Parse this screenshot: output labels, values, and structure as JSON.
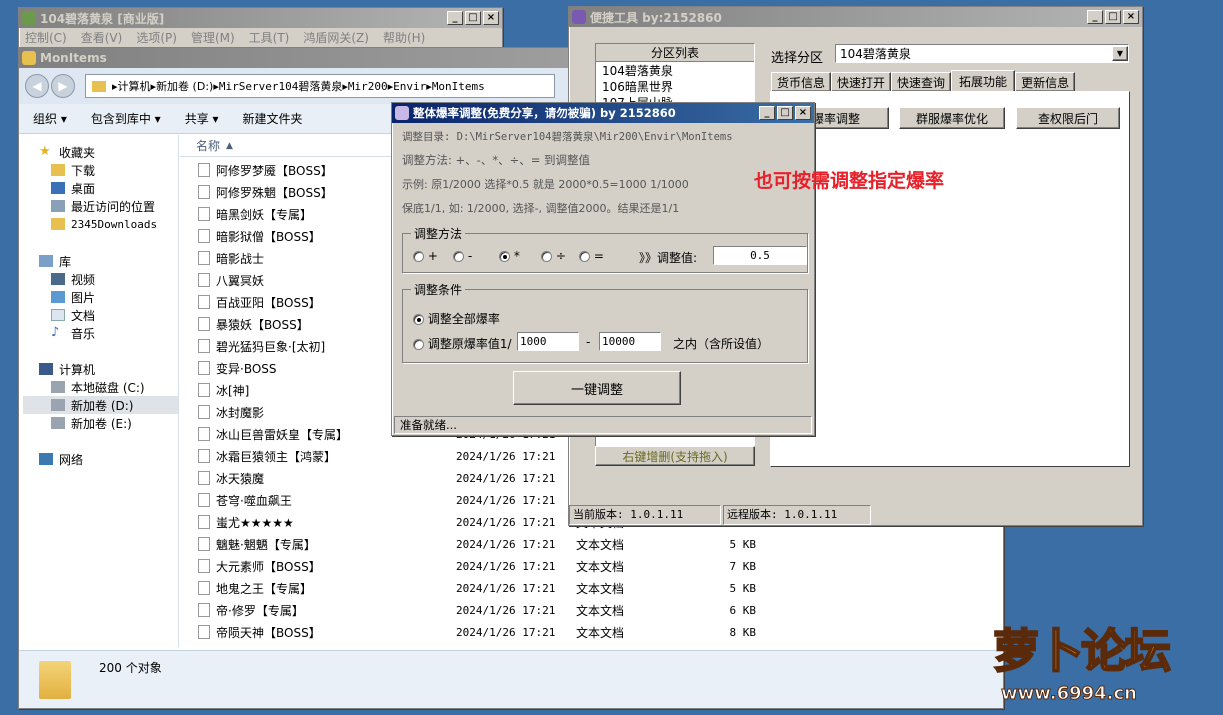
{
  "bg_window": {
    "title": "104碧落黄泉 [商业版]",
    "menu": [
      "控制(C)",
      "查看(V)",
      "选项(P)",
      "管理(M)",
      "工具(T)",
      "鸿盾网关(Z)",
      "帮助(H)"
    ]
  },
  "explorer": {
    "title": "MonItems",
    "path": [
      "计算机",
      "新加卷 (D:)",
      "MirServer104碧落黄泉",
      "Mir200",
      "Envir",
      "MonItems"
    ],
    "toolbar": [
      "组织 ▾",
      "包含到库中 ▾",
      "共享 ▾",
      "新建文件夹"
    ],
    "col_name": "名称",
    "sidebar": {
      "favorites": "收藏夹",
      "fav_items": [
        "下载",
        "桌面",
        "最近访问的位置",
        "2345Downloads"
      ],
      "libraries": "库",
      "lib_items": [
        "视频",
        "图片",
        "文档",
        "音乐"
      ],
      "computer": "计算机",
      "comp_items": [
        "本地磁盘 (C:)",
        "新加卷 (D:)",
        "新加卷 (E:)"
      ],
      "network": "网络"
    },
    "files": [
      {
        "name": "阿修罗梦魇【BOSS】",
        "date": "",
        "type": "",
        "size": ""
      },
      {
        "name": "阿修罗殊魍【BOSS】",
        "date": "",
        "type": "",
        "size": ""
      },
      {
        "name": "暗黑剑妖【专属】",
        "date": "",
        "type": "",
        "size": ""
      },
      {
        "name": "暗影狱僧【BOSS】",
        "date": "",
        "type": "",
        "size": ""
      },
      {
        "name": "暗影战士",
        "date": "",
        "type": "",
        "size": ""
      },
      {
        "name": "八翼冥妖",
        "date": "",
        "type": "",
        "size": ""
      },
      {
        "name": "百战亚阳【BOSS】",
        "date": "",
        "type": "",
        "size": ""
      },
      {
        "name": "暴猿妖【BOSS】",
        "date": "",
        "type": "",
        "size": ""
      },
      {
        "name": "碧光猛犸巨象·[太初]",
        "date": "",
        "type": "",
        "size": ""
      },
      {
        "name": "变异·BOSS",
        "date": "",
        "type": "",
        "size": ""
      },
      {
        "name": "冰[神]",
        "date": "",
        "type": "",
        "size": ""
      },
      {
        "name": "冰封魔影",
        "date": "",
        "type": "",
        "size": ""
      },
      {
        "name": "冰山巨兽雷妖皇【专属】",
        "date": "2024/1/26  17:21",
        "type": "",
        "size": ""
      },
      {
        "name": "冰霜巨猿领主【鸿蒙】",
        "date": "2024/1/26  17:21",
        "type": "",
        "size": ""
      },
      {
        "name": "冰天猿魔",
        "date": "2024/1/26  17:21",
        "type": "",
        "size": ""
      },
      {
        "name": "苍穹·噬血飙王",
        "date": "2024/1/26  17:21",
        "type": "",
        "size": ""
      },
      {
        "name": "蚩尤★★★★★",
        "date": "2024/1/26  17:21",
        "type": "文本文档",
        "size": "10 KB"
      },
      {
        "name": "魑魅·魍魉【专属】",
        "date": "2024/1/26  17:21",
        "type": "文本文档",
        "size": "5 KB"
      },
      {
        "name": "大元素师【BOSS】",
        "date": "2024/1/26  17:21",
        "type": "文本文档",
        "size": "7 KB"
      },
      {
        "name": "地鬼之王【专属】",
        "date": "2024/1/26  17:21",
        "type": "文本文档",
        "size": "5 KB"
      },
      {
        "name": "帝·修罗【专属】",
        "date": "2024/1/26  17:21",
        "type": "文本文档",
        "size": "6 KB"
      },
      {
        "name": "帝陨天神【BOSS】",
        "date": "2024/1/26  17:21",
        "type": "文本文档",
        "size": "8 KB"
      }
    ],
    "status": "200 个对象"
  },
  "tools": {
    "title": "便捷工具    by:2152860",
    "region_list_header": "分区列表",
    "regions": [
      "104碧落黄泉",
      "106暗黑世界",
      "107上层山脉"
    ],
    "select_label": "选择分区",
    "select_value": "104碧落黄泉",
    "tabs": [
      "货币信息",
      "快速打开",
      "快速查询",
      "拓展功能",
      "更新信息"
    ],
    "buttons": [
      "爆率调整",
      "群服爆率优化",
      "查权限后门"
    ],
    "right_click_hint": "右键增删(支持拖入)",
    "cur_version": "当前版本: 1.0.1.11",
    "remote_version": "远程版本: 1.0.1.11"
  },
  "dialog": {
    "title": "整体爆率调整(免费分享，请勿被骗)    by 2152860",
    "dir_line": "调整目录: D:\\MirServer104碧落黄泉\\Mir200\\Envir\\MonItems",
    "method_line": "调整方法: +、-、*、÷、=   到调整值",
    "example_line": "示例: 原1/2000 选择*0.5 就是 2000*0.5=1000  1/1000",
    "floor_line": "保底1/1, 如: 1/2000, 选择-, 调整值2000。结果还是1/1",
    "group_method": "调整方法",
    "ops": [
      "+",
      "-",
      "*",
      "÷",
      "="
    ],
    "value_label": "》》调整值:",
    "value": "0.5",
    "group_cond": "调整条件",
    "cond_all": "调整全部爆率",
    "cond_range": "调整原爆率值1/",
    "range_from": "1000",
    "range_to": "10000",
    "range_dash": "-",
    "range_suffix": "之内（含所设值）",
    "go_button": "一键调整",
    "status": "准备就绪..."
  },
  "annotation": "也可按需调整指定爆率",
  "watermark": {
    "brand": "萝卜论坛",
    "url": "www.6994.cn"
  },
  "colors": {
    "desktop": "#3a6ea5",
    "annotation": "#e8202a",
    "title_active": "#0a246a"
  }
}
